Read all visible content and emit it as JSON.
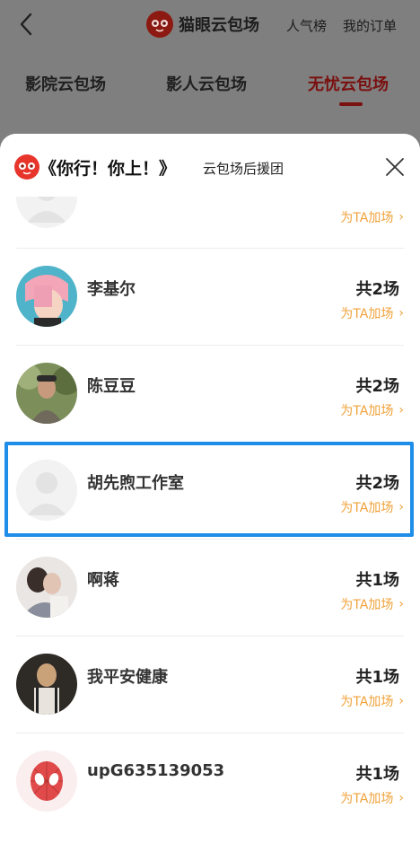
{
  "background": {
    "brand_title": "猫眼云包场",
    "nav": [
      "人气榜",
      "我的订单"
    ],
    "tabs": [
      {
        "label": "影院云包场",
        "active": false
      },
      {
        "label": "影人云包场",
        "active": false
      },
      {
        "label": "无忧云包场",
        "active": true
      }
    ]
  },
  "sheet": {
    "title": "《你行！你上！》",
    "subtitle": "云包场后援团",
    "support_label": "为TA加场",
    "rows": [
      {
        "name": "李基尔",
        "count": "共2场",
        "avatar": "photo-pink-hair"
      },
      {
        "name": "陈豆豆",
        "count": "共2场",
        "avatar": "photo-man-outdoor"
      },
      {
        "name": "胡先煦工作室",
        "count": "共2场",
        "avatar": "default-avatar"
      },
      {
        "name": "啊蒋",
        "count": "共1场",
        "avatar": "photo-couple"
      },
      {
        "name": "我平安健康",
        "count": "共1场",
        "avatar": "photo-man-suspenders"
      },
      {
        "name": "upG635139053",
        "count": "共1场",
        "avatar": "spiderman-avatar"
      }
    ]
  },
  "colors": {
    "accent_red": "#7a1010",
    "support_orange": "#f0a23a",
    "highlight_blue": "#1f8ee8"
  }
}
